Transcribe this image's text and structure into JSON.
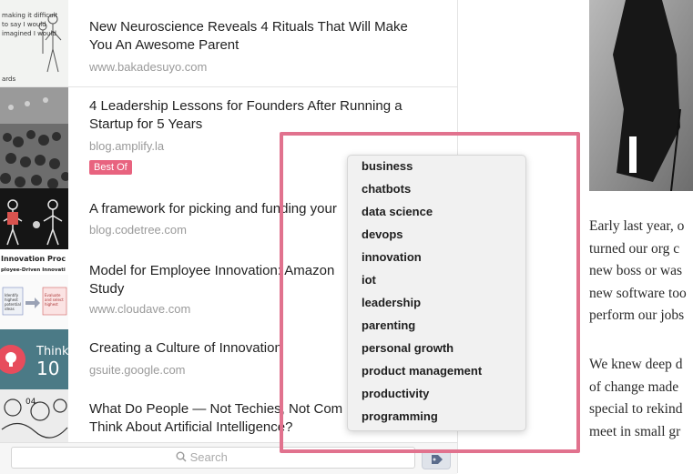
{
  "articles": [
    {
      "title_lines": [
        "New Neuroscience Reveals 4 Rituals That Will Make",
        "You An Awesome Parent"
      ],
      "domain": "www.bakadesuyo.com",
      "thumb_text": [
        "making it difficult",
        "to say I would",
        "imagined I would",
        "ards"
      ]
    },
    {
      "title_lines": [
        "4 Leadership Lessons for Founders After Running a",
        "Startup for 5 Years"
      ],
      "domain": "blog.amplify.la",
      "badge": "Best Of"
    },
    {
      "title_lines": [
        "A framework for picking and funding your"
      ],
      "domain": "blog.codetree.com"
    },
    {
      "title_lines": [
        "Model for Employee Innovation: Amazon",
        "Study"
      ],
      "domain": "www.cloudave.com",
      "thumb_text": [
        "Innovation Proc",
        "ployee-Driven Innovati",
        "Identify",
        "highest",
        "potential",
        "ideas",
        "Evaluate",
        "and select",
        "highest"
      ]
    },
    {
      "title_lines": [
        "Creating a Culture of Innovation"
      ],
      "domain": "gsuite.google.com",
      "thumb_text": [
        "Think",
        "10"
      ]
    },
    {
      "title_lines": [
        "What Do People — Not Techies, Not Com",
        "Think About Artificial Intelligence?"
      ],
      "domain": "",
      "thumb_text": [
        "04"
      ]
    }
  ],
  "search": {
    "placeholder": "Search"
  },
  "tag_menu": {
    "items": [
      "business",
      "chatbots",
      "data science",
      "devops",
      "innovation",
      "iot",
      "leadership",
      "parenting",
      "personal growth",
      "product management",
      "productivity",
      "programming"
    ]
  },
  "article_view": {
    "paragraph1": [
      "Early last year, o",
      "turned our org c",
      "new boss or was",
      "new software too",
      "perform our jobs"
    ],
    "paragraph2": [
      "We knew deep d",
      "of change made",
      "special to rekind",
      "meet in small gr"
    ]
  },
  "colors": {
    "badge": "#e8637f",
    "highlight": "#e1728e",
    "menu_bg": "#f1f1f1"
  },
  "icons": {
    "search": "search-icon",
    "tag": "tag-icon"
  }
}
